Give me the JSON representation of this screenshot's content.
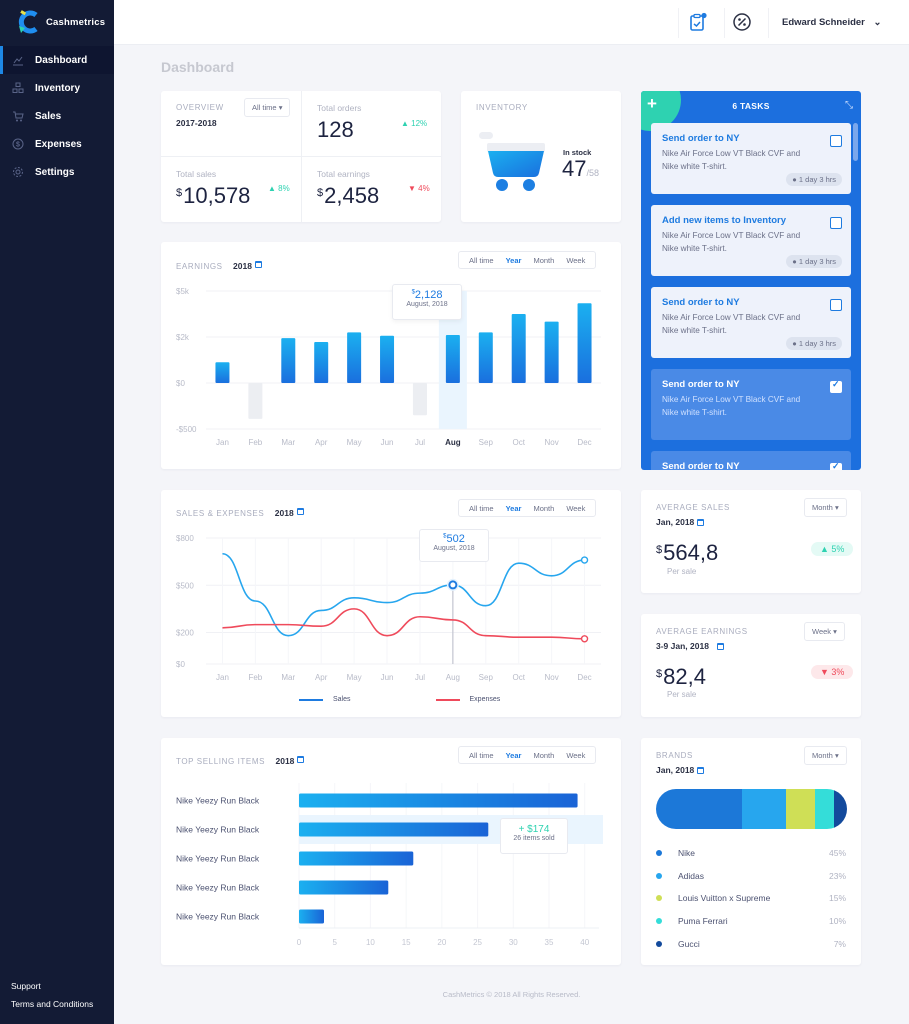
{
  "app": {
    "name": "Cashmetrics",
    "page_title": "Dashboard"
  },
  "colors": {
    "primary": "#1e7be0",
    "accent": "#2ed2b1",
    "danger": "#ef4a5b",
    "sidebar": "#131b35"
  },
  "sidebar": {
    "items": [
      {
        "label": "Dashboard",
        "icon": "chart-line-icon",
        "active": true
      },
      {
        "label": "Inventory",
        "icon": "boxes-icon"
      },
      {
        "label": "Sales",
        "icon": "cart-icon"
      },
      {
        "label": "Expenses",
        "icon": "dollar-circle-icon"
      },
      {
        "label": "Settings",
        "icon": "gear-icon"
      }
    ],
    "bottom": [
      "Support",
      "Terms and Conditions"
    ]
  },
  "topbar": {
    "user_name": "Edward Schneider",
    "icons": [
      "clipboard-check-icon",
      "percent-icon"
    ]
  },
  "overview": {
    "label": "Overview",
    "period": "2017-2018",
    "dropdown": "All time",
    "total_orders": {
      "label": "Total orders",
      "value": "128",
      "change": "▲ 12%"
    },
    "total_sales": {
      "label": "Total sales",
      "currency": "$",
      "value": "10,578",
      "change": "▲ 8%"
    },
    "total_earnings": {
      "label": "Total earnings",
      "currency": "$",
      "value": "2,458",
      "change": "▼ 4%"
    }
  },
  "inventory": {
    "label": "Inventory",
    "in_stock_label": "In stock",
    "in_stock": "47",
    "total": "/58"
  },
  "tasks": {
    "title": "6 TASKS",
    "add": "+",
    "items": [
      {
        "title": "Send order to NY",
        "desc": "Nike Air Force Low VT Black CVF and Nike white T-shirt.",
        "time": "1 day 3 hrs",
        "done": false
      },
      {
        "title": "Add new items to Inventory",
        "desc": "Nike Air Force Low VT Black CVF and Nike white T-shirt.",
        "time": "1 day 3 hrs",
        "done": false
      },
      {
        "title": "Send order to NY",
        "desc": "Nike Air Force Low VT Black CVF and Nike white T-shirt.",
        "time": "1 day 3 hrs",
        "done": false
      },
      {
        "title": "Send order to NY",
        "desc": "Nike Air Force Low VT Black CVF and Nike white T-shirt.",
        "done": true
      },
      {
        "title": "Send order to NY",
        "desc": "",
        "done": true
      }
    ]
  },
  "filters": [
    "All time",
    "Year",
    "Month",
    "Week"
  ],
  "earnings": {
    "label": "Earnings",
    "year": "2018",
    "tooltip": {
      "currency": "$",
      "value": "2,128",
      "date": "August, 2018"
    }
  },
  "sales_expenses": {
    "label": "Sales & Expenses",
    "year": "2018",
    "tooltip": {
      "currency": "$",
      "value": "502",
      "date": "August, 2018"
    },
    "legend": [
      "Sales",
      "Expenses"
    ]
  },
  "top_selling": {
    "label": "Top selling items",
    "year": "2018",
    "tooltip": {
      "value": "+ $174",
      "sub": "26 items sold"
    }
  },
  "average_sales": {
    "label": "Average sales",
    "date": "Jan, 2018",
    "dropdown": "Month",
    "currency": "$",
    "value": "564,8",
    "unit": "Per sale",
    "change": "▲ 5%"
  },
  "average_earnings": {
    "label": "Average earnings",
    "date": "3-9 Jan, 2018",
    "dropdown": "Week",
    "currency": "$",
    "value": "82,4",
    "unit": "Per sale",
    "change": "▼ 3%"
  },
  "brands": {
    "label": "Brands",
    "date": "Jan, 2018",
    "dropdown": "Month",
    "items": [
      {
        "name": "Nike",
        "pct": "45%",
        "value": 45,
        "color": "#1c78d8"
      },
      {
        "name": "Adidas",
        "pct": "23%",
        "value": 23,
        "color": "#27a6ee"
      },
      {
        "name": "Louis Vuitton x Supreme",
        "pct": "15%",
        "value": 15,
        "color": "#cfdf56"
      },
      {
        "name": "Puma Ferrari",
        "pct": "10%",
        "value": 10,
        "color": "#34ddd9"
      },
      {
        "name": "Gucci",
        "pct": "7%",
        "value": 7,
        "color": "#134a9c"
      }
    ]
  },
  "footer": "CashMetrics © 2018 All Rights Reserved.",
  "chart_data": [
    {
      "type": "bar",
      "title": "Earnings 2018",
      "categories": [
        "Jan",
        "Feb",
        "Mar",
        "Apr",
        "May",
        "Jun",
        "Jul",
        "Aug",
        "Sep",
        "Oct",
        "Nov",
        "Dec"
      ],
      "values": [
        900,
        -390,
        1950,
        1780,
        2300,
        2080,
        -350,
        2128,
        2300,
        3500,
        3000,
        4200
      ],
      "yticks": [
        "$5k",
        "$2k",
        "$0",
        "-$500"
      ],
      "ylim": [
        -500,
        5000
      ],
      "highlight": "Aug"
    },
    {
      "type": "line",
      "title": "Sales & Expenses 2018",
      "categories": [
        "Jan",
        "Feb",
        "Mar",
        "Apr",
        "May",
        "Jun",
        "Jul",
        "Aug",
        "Sep",
        "Oct",
        "Nov",
        "Dec"
      ],
      "series": [
        {
          "name": "Sales",
          "color": "#27a6ee",
          "values": [
            700,
            400,
            180,
            340,
            420,
            390,
            450,
            502,
            370,
            640,
            560,
            660
          ]
        },
        {
          "name": "Expenses",
          "color": "#ef4a5b",
          "values": [
            230,
            250,
            250,
            240,
            350,
            180,
            300,
            280,
            180,
            170,
            170,
            160
          ]
        }
      ],
      "yticks": [
        "$800",
        "$500",
        "$200",
        "$0"
      ],
      "ylim": [
        0,
        800
      ],
      "highlight": "Aug"
    },
    {
      "type": "bar",
      "orientation": "horizontal",
      "title": "Top selling items 2018",
      "categories": [
        "Nike Yeezy Run Black",
        "Nike Yeezy Run Black",
        "Nike Yeezy Run Black",
        "Nike Yeezy Run Black",
        "Nike Yeezy Run Black"
      ],
      "values": [
        39,
        26.5,
        16,
        12.5,
        3.5
      ],
      "xticks": [
        "0",
        "5",
        "10",
        "15",
        "20",
        "25",
        "30",
        "35",
        "40"
      ],
      "xlim": [
        0,
        42
      ]
    }
  ]
}
